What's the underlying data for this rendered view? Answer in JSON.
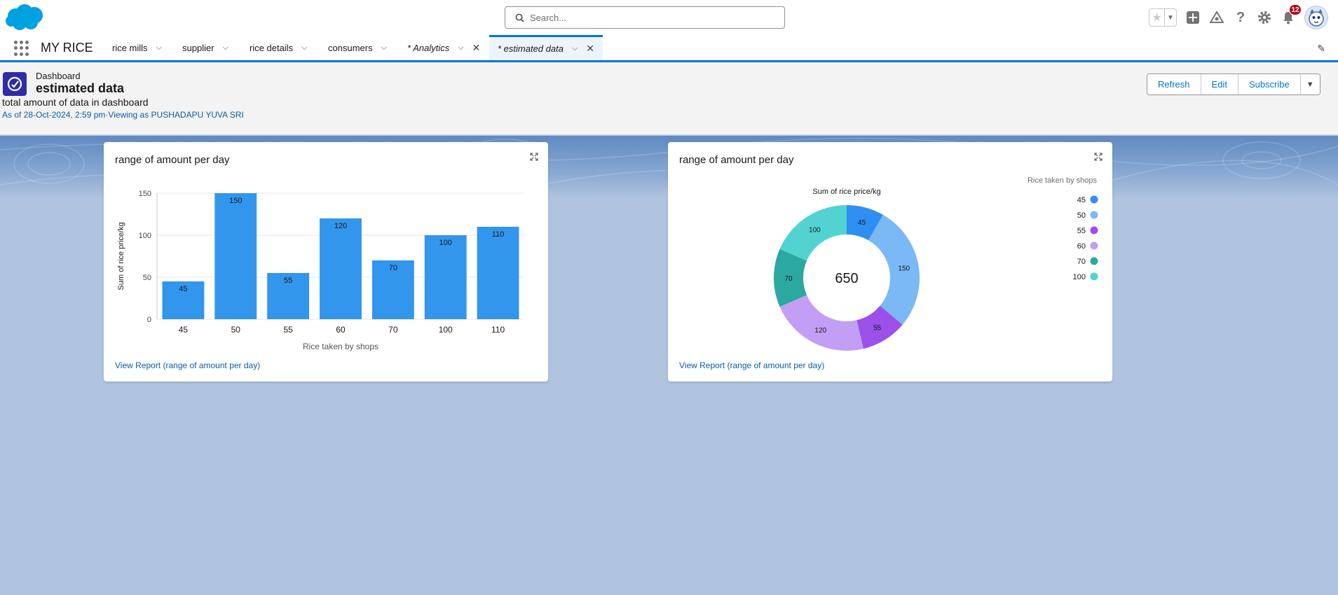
{
  "header": {
    "search_placeholder": "Search...",
    "notifications_count": "12"
  },
  "nav": {
    "app_name": "MY RICE",
    "tabs": [
      {
        "label": "rice mills"
      },
      {
        "label": "supplier"
      },
      {
        "label": "rice details"
      },
      {
        "label": "consumers"
      },
      {
        "label": "* Analytics"
      },
      {
        "label": "* estimated data"
      }
    ]
  },
  "dashboard": {
    "type_label": "Dashboard",
    "title": "estimated data",
    "description": "total amount of data in dashboard",
    "meta": "As of 28-Oct-2024, 2:59 pm·Viewing as PUSHADAPU YUVA SRI",
    "buttons": {
      "refresh": "Refresh",
      "edit": "Edit",
      "subscribe": "Subscribe"
    }
  },
  "cards": [
    {
      "title": "range of amount per day",
      "link": "View Report (range of amount per day)"
    },
    {
      "title": "range of amount per day",
      "link": "View Report (range of amount per day)"
    }
  ],
  "chart_data": [
    {
      "type": "bar",
      "title": "",
      "xlabel": "Rice taken by shops",
      "ylabel": "Sum of rice price/kg",
      "categories": [
        "45",
        "50",
        "55",
        "60",
        "70",
        "100",
        "110"
      ],
      "values": [
        45,
        150,
        55,
        120,
        70,
        100,
        110
      ],
      "yticks": [
        "0",
        "50",
        "100",
        "150"
      ],
      "ylim": [
        0,
        150
      ],
      "color": "#3296ed",
      "grid": true
    },
    {
      "type": "pie",
      "subtitle": "Sum of rice price/kg",
      "legend_title": "Rice taken by shops",
      "legend_position": "top-right",
      "center_total": "650",
      "slices": [
        {
          "label": "45",
          "value": 45,
          "color": "#2f8ff0"
        },
        {
          "label": "50",
          "value": 150,
          "color": "#7ab8f6"
        },
        {
          "label": "55",
          "value": 55,
          "color": "#9b50ea"
        },
        {
          "label": "60",
          "value": 120,
          "color": "#c39ef5"
        },
        {
          "label": "70",
          "value": 70,
          "color": "#2ba8a0"
        },
        {
          "label": "100",
          "value": 100,
          "color": "#52d3d2"
        }
      ]
    }
  ]
}
